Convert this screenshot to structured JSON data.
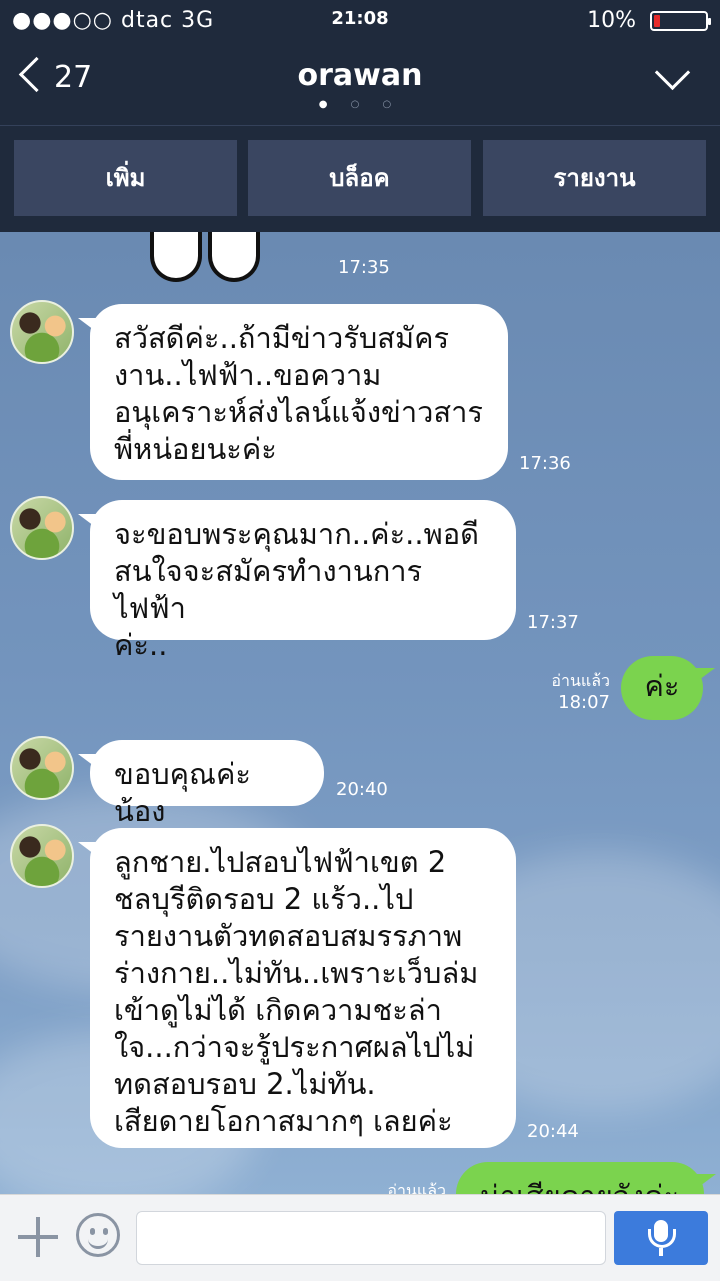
{
  "status_bar": {
    "signal": "●●●○○ dtac   3G",
    "time": "21:08",
    "battery": "10%",
    "battery_color": "#e62b2b"
  },
  "header": {
    "back_count": "27",
    "title": "orawan",
    "dots": "● ○ ○"
  },
  "actions": [
    {
      "label": "เพิ่ม"
    },
    {
      "label": "บล็อค"
    },
    {
      "label": "รายงาน"
    }
  ],
  "messages": [
    {
      "direction": "in",
      "type": "sticker",
      "time": "17:35"
    },
    {
      "direction": "in",
      "text": "สวัสดีค่ะ..ถ้ามีข่าวรับสมัคร\nงาน..ไฟฟ้า..ขอความ\nอนุเคราะห์ส่งไลน์แจ้งข่าวสาร\nพี่หน่อยนะค่ะ",
      "time": "17:36"
    },
    {
      "direction": "in",
      "text": "จะขอบพระคุณมาก..ค่ะ..พอดี\nสนใจจะสมัครทำงานการไฟฟ้า\nค่ะ..",
      "time": "17:37"
    },
    {
      "direction": "out",
      "text": "ค่ะ",
      "read": "อ่านแล้ว",
      "time": "18:07"
    },
    {
      "direction": "in",
      "text": "ขอบคุณค่ะน้อง",
      "time": "20:40"
    },
    {
      "direction": "in",
      "text": "ลูกชาย.ไปสอบไฟฟ้าเขต 2\nชลบุรีติดรอบ 2 แร้ว..ไป\nรายงานตัวทดสอบสมรรภาพ\nร่างกาย..ไม่ทัน..เพราะเว็บล่ม\nเข้าดูไม่ได้  เกิดความชะล่า\nใจ...กว่าจะรู้ประกาศผลไปไม่\nทดสอบรอบ 2.ไม่ทัน.\nเสียดายโอกาสมากๆ เลยค่ะ",
      "time": "20:44"
    },
    {
      "direction": "out",
      "text": "น่าเสียดายจังค่ะ",
      "read": "อ่านแล้ว"
    }
  ],
  "input_bar": {
    "placeholder": "",
    "accent": "#3c7bdc"
  },
  "colors": {
    "header_bg": "#1f2a3c",
    "outgoing_bubble": "#7bd34e",
    "incoming_bubble": "#ffffff"
  }
}
